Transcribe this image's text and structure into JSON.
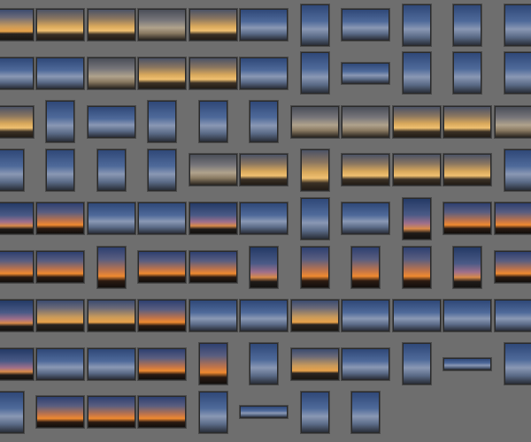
{
  "grid": {
    "rows": [
      [
        [
          "L",
          "sunset"
        ],
        [
          "L",
          "gold"
        ],
        [
          "L",
          "gold"
        ],
        [
          "L",
          "gray"
        ],
        [
          "L",
          "gold"
        ],
        [
          "L",
          "blue"
        ],
        [
          "P",
          "blue"
        ],
        [
          "L",
          "blue"
        ],
        [
          "P",
          "blue"
        ],
        [
          "P",
          "blue"
        ],
        [
          "P",
          "blue"
        ]
      ],
      [
        [
          "L",
          "blue"
        ],
        [
          "L",
          "blue"
        ],
        [
          "L",
          "gray"
        ],
        [
          "L",
          "gold"
        ],
        [
          "L",
          "gold"
        ],
        [
          "L",
          "blue"
        ],
        [
          "P",
          "blue"
        ],
        [
          "S",
          "blue"
        ],
        [
          "P",
          "blue"
        ],
        [
          "P",
          "blue"
        ],
        [
          "P",
          "blue"
        ]
      ],
      [
        [
          "L",
          "gold"
        ],
        [
          "P",
          "blue"
        ],
        [
          "L",
          "blue"
        ],
        [
          "P",
          "blue"
        ],
        [
          "P",
          "blue"
        ],
        [
          "P",
          "blue"
        ],
        [
          "L",
          "gray"
        ],
        [
          "L",
          "gray"
        ],
        [
          "L",
          "gold"
        ],
        [
          "L",
          "gold"
        ],
        [
          "L",
          "gray"
        ]
      ],
      [
        [
          "P",
          "blue"
        ],
        [
          "P",
          "blue"
        ],
        [
          "P",
          "blue"
        ],
        [
          "P",
          "blue"
        ],
        [
          "L",
          "gray"
        ],
        [
          "L",
          "gold"
        ],
        [
          "P",
          "gold"
        ],
        [
          "L",
          "gold"
        ],
        [
          "L",
          "gold"
        ],
        [
          "L",
          "gold"
        ],
        [
          "P",
          "blue"
        ]
      ],
      [
        [
          "L",
          "dusk"
        ],
        [
          "L",
          "orange"
        ],
        [
          "L",
          "blue"
        ],
        [
          "L",
          "blue"
        ],
        [
          "L",
          "dusk"
        ],
        [
          "L",
          "blue"
        ],
        [
          "P",
          "blue"
        ],
        [
          "L",
          "blue"
        ],
        [
          "P",
          "dusk"
        ],
        [
          "L",
          "orange"
        ],
        [
          "L",
          "orange"
        ]
      ],
      [
        [
          "L",
          "orange"
        ],
        [
          "L",
          "orange"
        ],
        [
          "P",
          "orange"
        ],
        [
          "L",
          "orange"
        ],
        [
          "L",
          "orange"
        ],
        [
          "P",
          "dusk"
        ],
        [
          "P",
          "orange"
        ],
        [
          "P",
          "orange"
        ],
        [
          "P",
          "orange"
        ],
        [
          "P",
          "dusk"
        ],
        [
          "L",
          "orange"
        ]
      ],
      [
        [
          "L",
          "dusk"
        ],
        [
          "L",
          "sunset"
        ],
        [
          "L",
          "sunset"
        ],
        [
          "L",
          "orange"
        ],
        [
          "L",
          "blue"
        ],
        [
          "L",
          "blue"
        ],
        [
          "L",
          "sunset"
        ],
        [
          "L",
          "blue"
        ],
        [
          "L",
          "blue"
        ],
        [
          "L",
          "blue"
        ],
        [
          "L",
          "blue"
        ]
      ],
      [
        [
          "L",
          "dusk"
        ],
        [
          "L",
          "blue"
        ],
        [
          "L",
          "blue"
        ],
        [
          "L",
          "orange"
        ],
        [
          "P",
          "orange"
        ],
        [
          "P",
          "blue"
        ],
        [
          "L",
          "sunset"
        ],
        [
          "L",
          "blue"
        ],
        [
          "P",
          "blue"
        ],
        [
          "W",
          "blue"
        ],
        [
          "P",
          "blue"
        ]
      ],
      [
        [
          "P",
          "blue"
        ],
        [
          "L",
          "orange"
        ],
        [
          "L",
          "orange"
        ],
        [
          "L",
          "orange"
        ],
        [
          "P",
          "blue"
        ],
        [
          "W",
          "blue"
        ],
        [
          "P",
          "blue"
        ],
        [
          "P",
          "blue"
        ]
      ]
    ]
  }
}
